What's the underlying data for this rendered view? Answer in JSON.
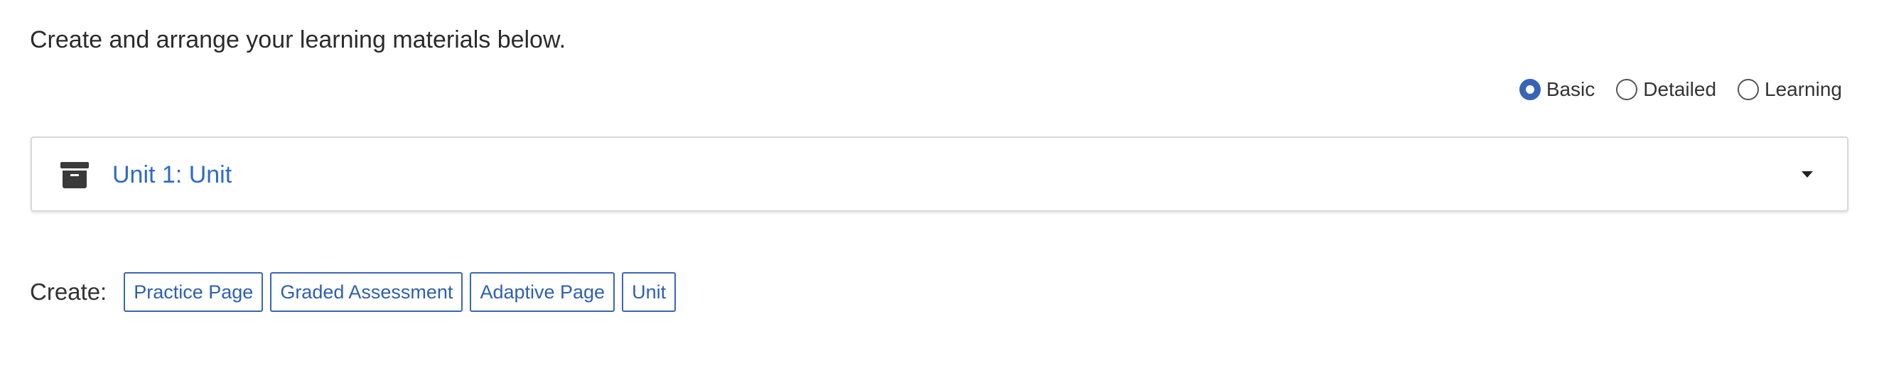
{
  "intro": {
    "text": "Create and arrange your learning materials below."
  },
  "view_options": {
    "selected": "Basic",
    "options": [
      {
        "label": "Basic",
        "checked": true
      },
      {
        "label": "Detailed",
        "checked": false
      },
      {
        "label": "Learning",
        "checked": false
      }
    ]
  },
  "unit_card": {
    "title": "Unit 1: Unit",
    "icon": "archive-box-icon",
    "expand_icon": "caret-down-icon"
  },
  "create": {
    "label": "Create:",
    "buttons": [
      "Practice Page",
      "Graded Assessment",
      "Adaptive Page",
      "Unit"
    ]
  },
  "colors": {
    "accent": "#3565b4",
    "link": "#2f6ac9",
    "text": "#2b2b2b",
    "card_border": "#d9d9d9"
  }
}
